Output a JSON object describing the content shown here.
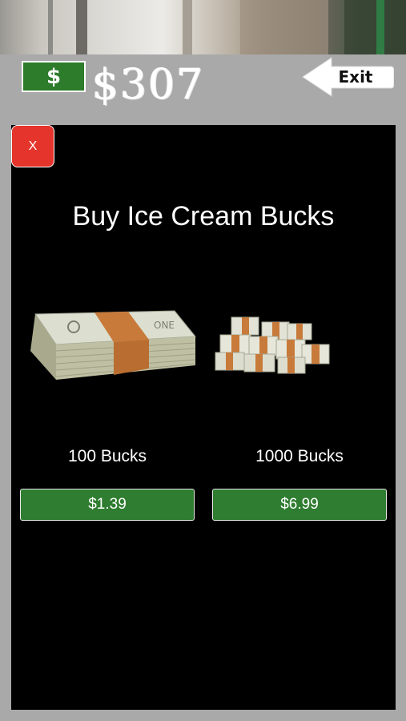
{
  "header": {
    "currency_symbol": "$",
    "balance": "$307",
    "exit_label": "Exit"
  },
  "store": {
    "close_label": "X",
    "title": "Buy Ice Cream Bucks",
    "offers": [
      {
        "name": "100 Bucks",
        "price": "$1.39",
        "image": "money-stack-icon"
      },
      {
        "name": "1000 Bucks",
        "price": "$6.99",
        "image": "money-pile-icon"
      }
    ]
  },
  "colors": {
    "panel": "#000000",
    "buy_button": "#2f7d30",
    "close_button": "#e4342b",
    "money_badge": "#2c7c2b",
    "frame": "#a9a9a9"
  }
}
